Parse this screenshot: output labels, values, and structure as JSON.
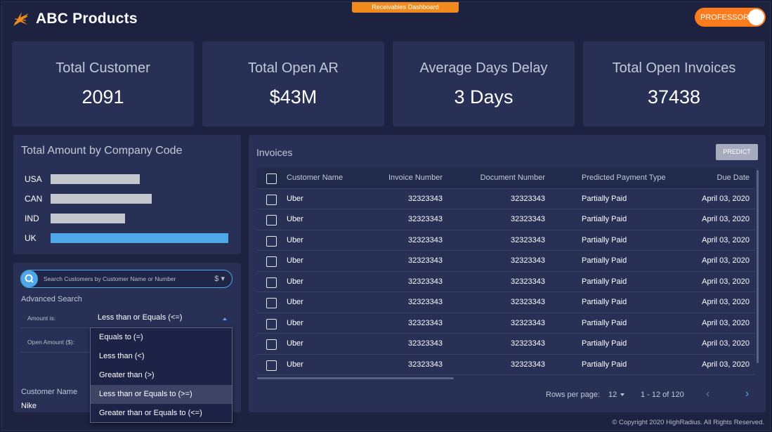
{
  "header": {
    "app_name": "ABC Products",
    "dashboard_tab": "Receivables Dashboard",
    "user_button": "PROFESSOR",
    "user_icon_glyph": "((•"
  },
  "kpis": [
    {
      "label": "Total Customer",
      "value": "2091"
    },
    {
      "label": "Total Open AR",
      "value": "$43M"
    },
    {
      "label": "Average Days Delay",
      "value": "3 Days"
    },
    {
      "label": "Total Open Invoices",
      "value": "37438"
    }
  ],
  "company_chart": {
    "title": "Total Amount by Company Code",
    "rows": [
      {
        "label": "USA"
      },
      {
        "label": "CAN"
      },
      {
        "label": "IND"
      },
      {
        "label": "UK"
      }
    ]
  },
  "chart_data": {
    "type": "bar",
    "title": "Total Amount by Company Code",
    "categories": [
      "USA",
      "CAN",
      "IND",
      "UK"
    ],
    "values": [
      0.5,
      0.57,
      0.42,
      1.0
    ],
    "highlight_category": "UK",
    "colors": {
      "default": "#c5c7cf",
      "highlight": "#4ea8e8"
    }
  },
  "search": {
    "placeholder": "Search Customers by Customer Name or Number",
    "currency": "$ ▾",
    "advanced_label": "Advanced Search",
    "amount_label": "Amount is:",
    "amount_value": "Less than or Equals (<=)",
    "open_amount_label": "Open Amount ($):",
    "customer_name_label": "Customer Name",
    "customer_name_value": "Nike"
  },
  "dropdown": {
    "options": [
      "Equals to (=)",
      "Less than (<)",
      "Greater than (>)",
      "Less than or Equals to (>=)",
      "Greater than or Equals to (<=)"
    ],
    "active_index": 3
  },
  "invoices": {
    "title": "Invoices",
    "predict_button": "PREDICT",
    "columns": [
      "Customer Name",
      "Invoice Number",
      "Document Number",
      "Predicted Payment Type",
      "Due Date"
    ],
    "rows": [
      {
        "customer": "Uber",
        "invoice": "32323343",
        "document": "32323343",
        "payment": "Partially Paid",
        "due": "April 03, 2020"
      },
      {
        "customer": "Uber",
        "invoice": "32323343",
        "document": "32323343",
        "payment": "Partially Paid",
        "due": "April 03, 2020"
      },
      {
        "customer": "Uber",
        "invoice": "32323343",
        "document": "32323343",
        "payment": "Partially Paid",
        "due": "April 03, 2020"
      },
      {
        "customer": "Uber",
        "invoice": "32323343",
        "document": "32323343",
        "payment": "Partially Paid",
        "due": "April 03, 2020"
      },
      {
        "customer": "Uber",
        "invoice": "32323343",
        "document": "32323343",
        "payment": "Partially Paid",
        "due": "April 03, 2020"
      },
      {
        "customer": "Uber",
        "invoice": "32323343",
        "document": "32323343",
        "payment": "Partially Paid",
        "due": "April 03, 2020"
      },
      {
        "customer": "Uber",
        "invoice": "32323343",
        "document": "32323343",
        "payment": "Partially Paid",
        "due": "April 03, 2020"
      },
      {
        "customer": "Uber",
        "invoice": "32323343",
        "document": "32323343",
        "payment": "Partially Paid",
        "due": "April 03, 2020"
      },
      {
        "customer": "Uber",
        "invoice": "32323343",
        "document": "32323343",
        "payment": "Partially Paid",
        "due": "April 03, 2020"
      }
    ],
    "pagination": {
      "rows_per_page_label": "Rows per page:",
      "rows_per_page_value": "12",
      "range": "1 - 12 of 120",
      "prev_icon": "‹",
      "next_icon": "›"
    }
  },
  "footer": {
    "copyright": "© Copyright 2020 HighRadius. All Rights Reserved."
  }
}
